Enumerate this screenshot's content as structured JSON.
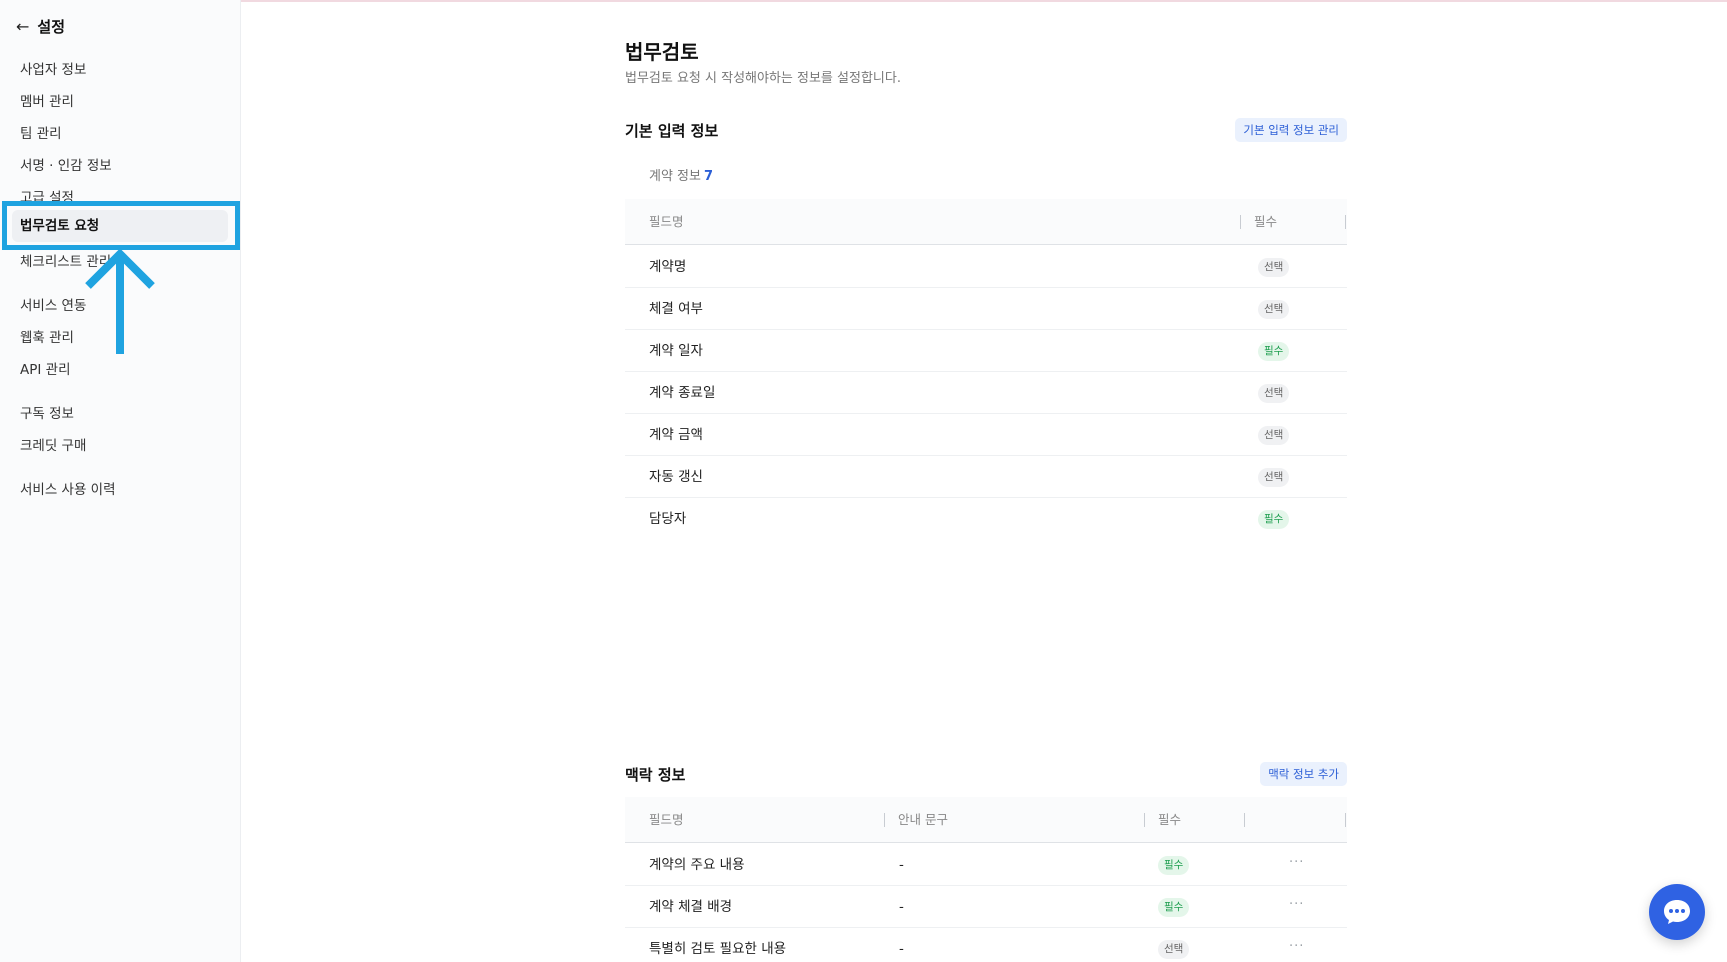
{
  "sidebar": {
    "title": "설정",
    "items": [
      {
        "label": "사업자 정보"
      },
      {
        "label": "멤버 관리"
      },
      {
        "label": "팀 관리"
      },
      {
        "label": "서명 · 인감 정보"
      },
      {
        "label": "고급 설정"
      },
      {
        "label": "법무검토 요청",
        "active": true
      },
      {
        "label": "체크리스트 관리"
      },
      {
        "label": "서비스 연동"
      },
      {
        "label": "웹훅 관리"
      },
      {
        "label": "API 관리"
      },
      {
        "label": "구독 정보"
      },
      {
        "label": "크레딧 구매"
      },
      {
        "label": "서비스 사용 이력"
      }
    ]
  },
  "page": {
    "title": "법무검토",
    "subtitle": "법무검토 요청 시 작성해야하는 정보를 설정합니다."
  },
  "basic_info": {
    "title": "기본 입력 정보",
    "manage_button": "기본 입력 정보 관리",
    "contract_info_label": "계약 정보",
    "contract_info_count": "7",
    "columns": {
      "field": "필드명",
      "required": "필수"
    },
    "rows": [
      {
        "name": "계약명",
        "badge": "선택",
        "type": "optional"
      },
      {
        "name": "체결 여부",
        "badge": "선택",
        "type": "optional"
      },
      {
        "name": "계약 일자",
        "badge": "필수",
        "type": "required"
      },
      {
        "name": "계약 종료일",
        "badge": "선택",
        "type": "optional"
      },
      {
        "name": "계약 금액",
        "badge": "선택",
        "type": "optional"
      },
      {
        "name": "자동 갱신",
        "badge": "선택",
        "type": "optional"
      },
      {
        "name": "담당자",
        "badge": "필수",
        "type": "required"
      }
    ]
  },
  "context_info": {
    "title": "맥락 정보",
    "add_button": "맥락 정보 추가",
    "columns": {
      "field": "필드명",
      "guide": "안내 문구",
      "required": "필수"
    },
    "rows": [
      {
        "name": "계약의 주요 내용",
        "guide": "-",
        "badge": "필수",
        "type": "required",
        "more": "···"
      },
      {
        "name": "계약 체결 배경",
        "guide": "-",
        "badge": "필수",
        "type": "required",
        "more": "···"
      },
      {
        "name": "특별히 검토 필요한 내용",
        "guide": "-",
        "badge": "선택",
        "type": "optional",
        "more": "···"
      }
    ]
  },
  "colors": {
    "accent": "#2c5fd6",
    "highlight": "#1fa3e0",
    "required_badge": "#1e9e4f",
    "chat_button": "#2f62e3"
  }
}
